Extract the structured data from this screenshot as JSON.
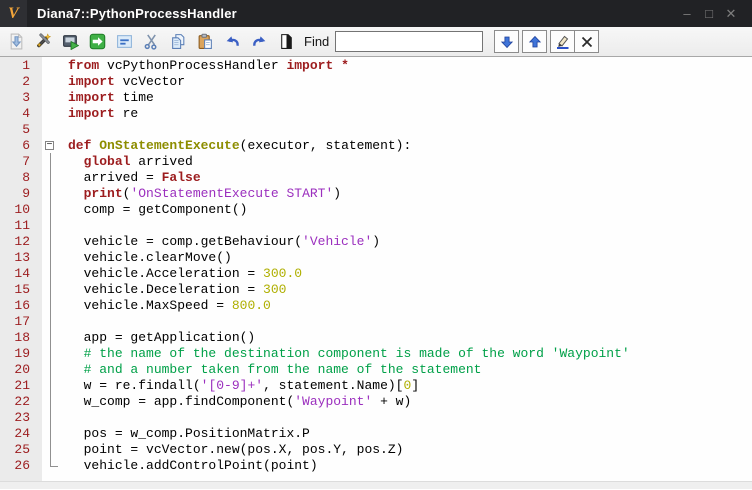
{
  "window": {
    "title": "Diana7::PythonProcessHandler",
    "logo_letter": "V",
    "controls": {
      "minimize": "–",
      "maximize": "□",
      "close": "✕"
    }
  },
  "toolbar": {
    "icons": [
      "import-script",
      "syntax-check-wand",
      "run-script",
      "apply-script",
      "indent-block",
      "cut",
      "copy",
      "paste",
      "undo",
      "redo",
      "find-in-document"
    ],
    "find_label": "Find",
    "search_value": "",
    "find_buttons": [
      "find-next",
      "find-previous",
      "highlight-all",
      "clear-search"
    ]
  },
  "colors": {
    "k": "#9c1c1e",
    "f": "#8d8d00",
    "s": "#9b2fbe",
    "c": "#00a048",
    "n": "#afaf00",
    "p": "#000000",
    "line_number": "#9c1c1e",
    "accent_blue": "#3a66c8",
    "titlebar": "#212225",
    "logo_orange": "#f2a53a"
  },
  "editor": {
    "fold": {
      "start": 6,
      "end": 26
    },
    "lines": [
      {
        "n": 1,
        "indent": 0,
        "segs": [
          {
            "c": "k",
            "t": "from"
          },
          {
            "c": "p",
            "t": " vcPythonProcessHandler "
          },
          {
            "c": "k",
            "t": "import"
          },
          {
            "c": "p",
            "t": " "
          },
          {
            "c": "k",
            "t": "*"
          }
        ]
      },
      {
        "n": 2,
        "indent": 0,
        "segs": [
          {
            "c": "k",
            "t": "import"
          },
          {
            "c": "p",
            "t": " vcVector"
          }
        ]
      },
      {
        "n": 3,
        "indent": 0,
        "segs": [
          {
            "c": "k",
            "t": "import"
          },
          {
            "c": "p",
            "t": " time"
          }
        ]
      },
      {
        "n": 4,
        "indent": 0,
        "segs": [
          {
            "c": "k",
            "t": "import"
          },
          {
            "c": "p",
            "t": " re"
          }
        ]
      },
      {
        "n": 5,
        "indent": 0,
        "segs": []
      },
      {
        "n": 6,
        "indent": 0,
        "segs": [
          {
            "c": "k",
            "t": "def"
          },
          {
            "c": "p",
            "t": " "
          },
          {
            "c": "f",
            "t": "OnStatementExecute"
          },
          {
            "c": "p",
            "t": "(executor, statement):"
          }
        ]
      },
      {
        "n": 7,
        "indent": 1,
        "segs": [
          {
            "c": "k",
            "t": "global"
          },
          {
            "c": "p",
            "t": " arrived"
          }
        ]
      },
      {
        "n": 8,
        "indent": 1,
        "segs": [
          {
            "c": "p",
            "t": "arrived = "
          },
          {
            "c": "k",
            "t": "False"
          }
        ]
      },
      {
        "n": 9,
        "indent": 1,
        "segs": [
          {
            "c": "k",
            "t": "print"
          },
          {
            "c": "p",
            "t": "("
          },
          {
            "c": "s",
            "t": "'OnStatementExecute START'"
          },
          {
            "c": "p",
            "t": ")"
          }
        ]
      },
      {
        "n": 10,
        "indent": 1,
        "segs": [
          {
            "c": "p",
            "t": "comp = getComponent()"
          }
        ]
      },
      {
        "n": 11,
        "indent": 1,
        "segs": []
      },
      {
        "n": 12,
        "indent": 1,
        "segs": [
          {
            "c": "p",
            "t": "vehicle = comp.getBehaviour("
          },
          {
            "c": "s",
            "t": "'Vehicle'"
          },
          {
            "c": "p",
            "t": ")"
          }
        ]
      },
      {
        "n": 13,
        "indent": 1,
        "segs": [
          {
            "c": "p",
            "t": "vehicle.clearMove()"
          }
        ]
      },
      {
        "n": 14,
        "indent": 1,
        "segs": [
          {
            "c": "p",
            "t": "vehicle.Acceleration = "
          },
          {
            "c": "n",
            "t": "300.0"
          }
        ]
      },
      {
        "n": 15,
        "indent": 1,
        "segs": [
          {
            "c": "p",
            "t": "vehicle.Deceleration = "
          },
          {
            "c": "n",
            "t": "300"
          }
        ]
      },
      {
        "n": 16,
        "indent": 1,
        "segs": [
          {
            "c": "p",
            "t": "vehicle.MaxSpeed = "
          },
          {
            "c": "n",
            "t": "800.0"
          }
        ]
      },
      {
        "n": 17,
        "indent": 1,
        "segs": []
      },
      {
        "n": 18,
        "indent": 1,
        "segs": [
          {
            "c": "p",
            "t": "app = getApplication()"
          }
        ]
      },
      {
        "n": 19,
        "indent": 1,
        "segs": [
          {
            "c": "c",
            "t": "# the name of the destination component is made of the word 'Waypoint'"
          }
        ]
      },
      {
        "n": 20,
        "indent": 1,
        "segs": [
          {
            "c": "c",
            "t": "# and a number taken from the name of the statement"
          }
        ]
      },
      {
        "n": 21,
        "indent": 1,
        "segs": [
          {
            "c": "p",
            "t": "w = re.findall("
          },
          {
            "c": "s",
            "t": "'[0-9]+'"
          },
          {
            "c": "p",
            "t": ", statement.Name)["
          },
          {
            "c": "n",
            "t": "0"
          },
          {
            "c": "p",
            "t": "]"
          }
        ]
      },
      {
        "n": 22,
        "indent": 1,
        "segs": [
          {
            "c": "p",
            "t": "w_comp = app.findComponent("
          },
          {
            "c": "s",
            "t": "'Waypoint'"
          },
          {
            "c": "p",
            "t": " + w)"
          }
        ]
      },
      {
        "n": 23,
        "indent": 1,
        "segs": []
      },
      {
        "n": 24,
        "indent": 1,
        "segs": [
          {
            "c": "p",
            "t": "pos = w_comp.PositionMatrix.P"
          }
        ]
      },
      {
        "n": 25,
        "indent": 1,
        "segs": [
          {
            "c": "p",
            "t": "point = vcVector.new(pos.X, pos.Y, pos.Z)"
          }
        ]
      },
      {
        "n": 26,
        "indent": 1,
        "segs": [
          {
            "c": "p",
            "t": "vehicle.addControlPoint(point)"
          }
        ]
      }
    ]
  }
}
